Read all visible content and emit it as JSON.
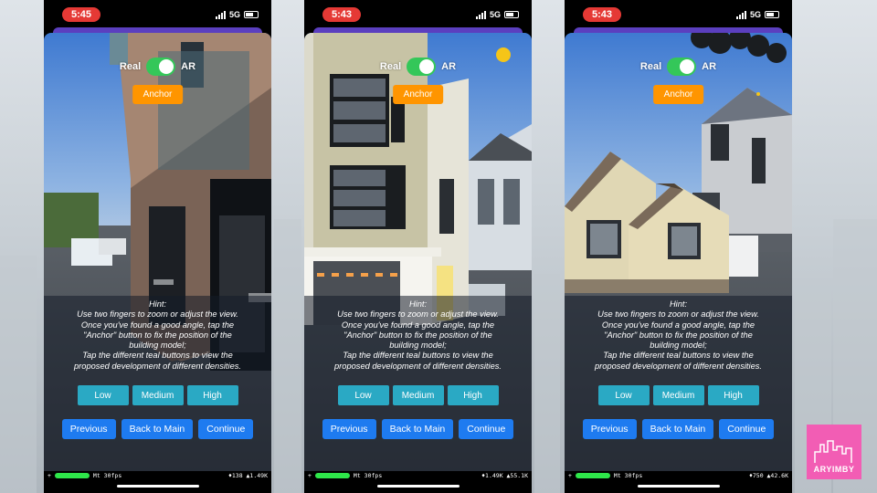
{
  "screens": [
    {
      "time": "5:45",
      "network": "5G",
      "toggle": {
        "left_label": "Real",
        "right_label": "AR"
      },
      "anchor_label": "Anchor",
      "hint": {
        "title": "Hint:",
        "lines": [
          "Use two fingers to zoom or adjust the view.",
          "Once you've found a good angle, tap the",
          "\"Anchor\" button to fix the position of the",
          "building model;",
          "Tap the different teal buttons to view the",
          "proposed development of different densities."
        ]
      },
      "density_buttons": [
        "Low",
        "Medium",
        "High"
      ],
      "nav_buttons": [
        "Previous",
        "Back to Main",
        "Continue"
      ],
      "debug": {
        "fps": "Mt 30fps",
        "stats": "♦138 ▲1.49K"
      }
    },
    {
      "time": "5:43",
      "network": "5G",
      "toggle": {
        "left_label": "Real",
        "right_label": "AR"
      },
      "anchor_label": "Anchor",
      "hint": {
        "title": "Hint:",
        "lines": [
          "Use two fingers to zoom or adjust the view.",
          "Once you've found a good angle, tap the",
          "\"Anchor\" button to fix the position of the",
          "building model;",
          "Tap the different teal buttons to view the",
          "proposed development of different densities."
        ]
      },
      "density_buttons": [
        "Low",
        "Medium",
        "High"
      ],
      "nav_buttons": [
        "Previous",
        "Back to Main",
        "Continue"
      ],
      "debug": {
        "fps": "Mt 30fps",
        "stats": "♦1.49K ▲55.1K"
      }
    },
    {
      "time": "5:43",
      "network": "5G",
      "toggle": {
        "left_label": "Real",
        "right_label": "AR"
      },
      "anchor_label": "Anchor",
      "hint": {
        "title": "Hint:",
        "lines": [
          "Use two fingers to zoom or adjust the view.",
          "Once you've found a good angle, tap the",
          "\"Anchor\" button to fix the position of the",
          "building model;",
          "Tap the different teal buttons to view the",
          "proposed development of different densities."
        ]
      },
      "density_buttons": [
        "Low",
        "Medium",
        "High"
      ],
      "nav_buttons": [
        "Previous",
        "Back to Main",
        "Continue"
      ],
      "debug": {
        "fps": "Mt 30fps",
        "stats": "♦750 ▲42.6K"
      }
    }
  ],
  "logo_text": "ARYIMBY",
  "colors": {
    "time_pill": "#e53935",
    "switch_on": "#34c759",
    "anchor": "#ff9500",
    "density_button": "#2aa9c4",
    "nav_button": "#1e7bf0",
    "logo_bg": "#f25db4"
  }
}
